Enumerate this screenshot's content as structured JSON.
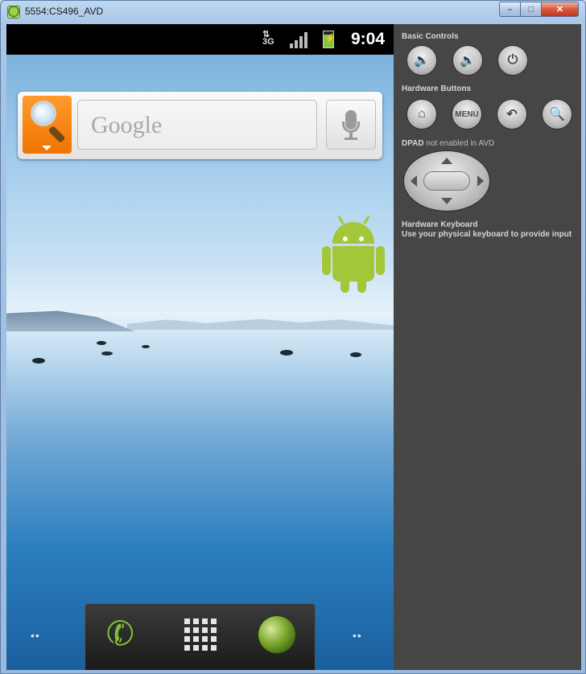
{
  "window": {
    "title": "5554:CS496_AVD",
    "minimize_glyph": "–",
    "maximize_glyph": "□",
    "close_glyph": "✕"
  },
  "statusbar": {
    "network_type": "3G",
    "time": "9:04"
  },
  "search_widget": {
    "placeholder": "Google"
  },
  "dock": {
    "phone_glyph": "✆"
  },
  "page_indicator": "••",
  "controls": {
    "basic_controls_label": "Basic Controls",
    "hardware_buttons_label": "Hardware Buttons",
    "menu_button_label": "MENU",
    "dpad_label": "DPAD",
    "dpad_note": "not enabled in AVD",
    "keyboard_label": "Hardware Keyboard",
    "keyboard_note": "Use your physical keyboard to provide input",
    "icons": {
      "volume_down": "🔈",
      "volume_up": "🔊",
      "power": "⏻",
      "home": "⌂",
      "back": "↶",
      "search": "🔍"
    }
  }
}
